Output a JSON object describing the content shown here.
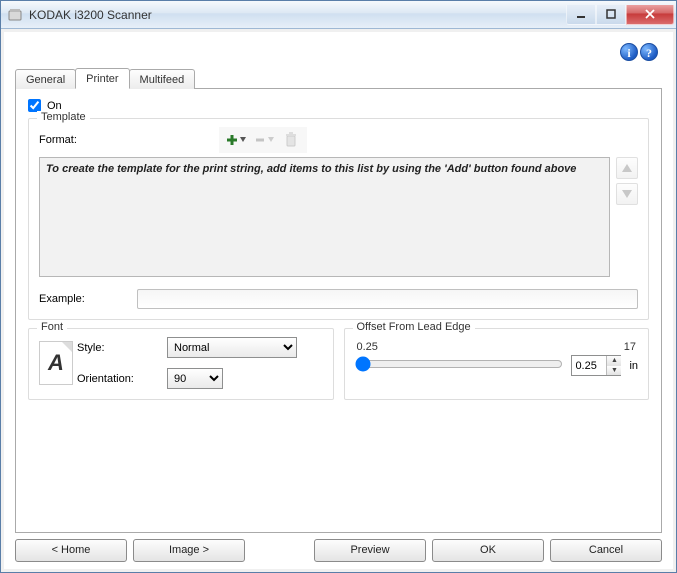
{
  "window": {
    "title": "KODAK i3200 Scanner"
  },
  "topIcons": {
    "info": "i",
    "help": "?"
  },
  "tabs": {
    "general": "General",
    "printer": "Printer",
    "multifeed": "Multifeed"
  },
  "on": {
    "label": "On",
    "checked": true
  },
  "template": {
    "legend": "Template",
    "formatLabel": "Format:",
    "placeholderText": "To create the template for the print string, add items to this list by using the 'Add' button found above",
    "exampleLabel": "Example:",
    "exampleValue": ""
  },
  "font": {
    "legend": "Font",
    "styleLabel": "Style:",
    "styleValue": "Normal",
    "orientationLabel": "Orientation:",
    "orientationValue": "90"
  },
  "offset": {
    "legend": "Offset From Lead Edge",
    "minLabel": "0.25",
    "maxLabel": "17",
    "value": "0.25",
    "unit": "in"
  },
  "footer": {
    "home": "< Home",
    "image": "Image >",
    "preview": "Preview",
    "ok": "OK",
    "cancel": "Cancel"
  }
}
